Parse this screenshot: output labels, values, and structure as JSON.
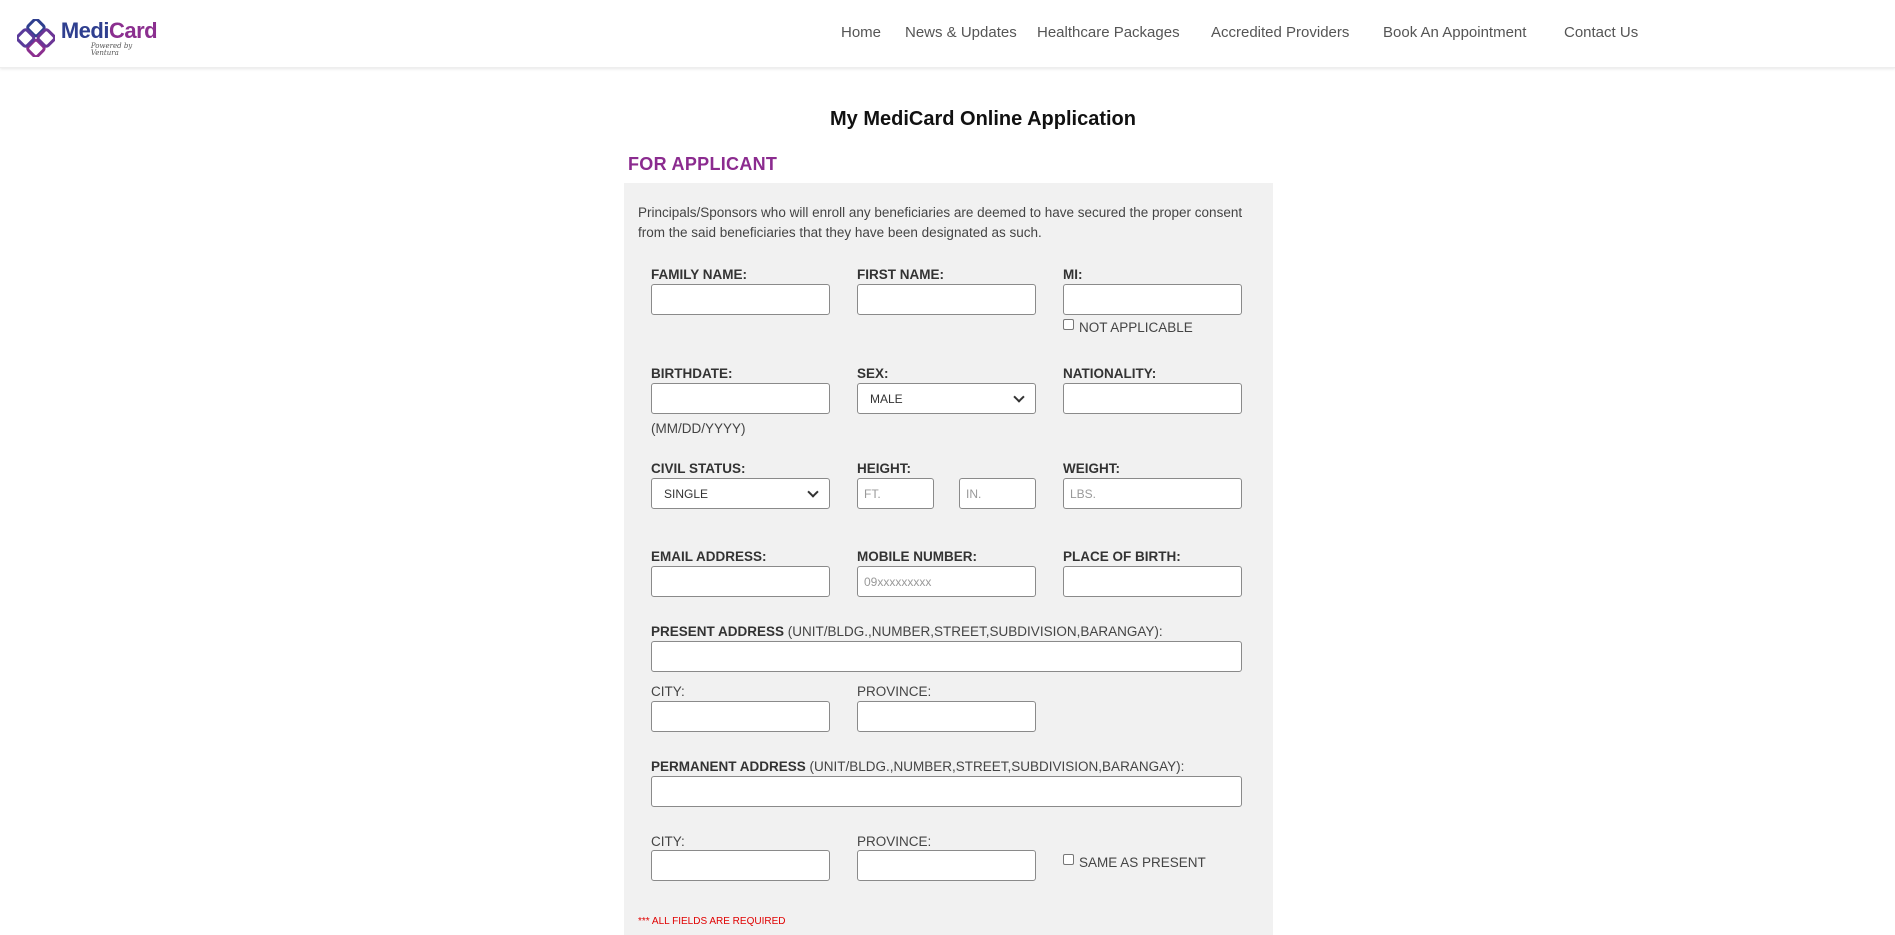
{
  "brand": {
    "name_part1": "Medi",
    "name_part2": "Card",
    "tagline": "Powered by Ventura",
    "colors": {
      "primary": "#2f3f8f",
      "accent": "#8b2f8f"
    }
  },
  "nav": {
    "items": [
      {
        "label": "Home"
      },
      {
        "label": "News & Updates"
      },
      {
        "label": "Healthcare Packages"
      },
      {
        "label": "Accredited Providers"
      },
      {
        "label": "Book An Appointment"
      },
      {
        "label": "Contact Us"
      }
    ]
  },
  "page": {
    "title": "My MediCard Online Application",
    "section_title": "FOR APPLICANT",
    "consent": "Principals/Sponsors who will enroll any beneficiaries are deemed to have secured the proper consent from the said beneficiaries that they have been designated as such."
  },
  "form": {
    "family_name": {
      "label": "FAMILY NAME:",
      "value": ""
    },
    "first_name": {
      "label": "FIRST NAME:",
      "value": ""
    },
    "mi": {
      "label": "MI:",
      "value": "",
      "not_applicable_label": "NOT APPLICABLE"
    },
    "birthdate": {
      "label": "BIRTHDATE:",
      "value": "",
      "hint": "(MM/DD/YYYY)"
    },
    "sex": {
      "label": "SEX:",
      "selected": "MALE"
    },
    "nationality": {
      "label": "NATIONALITY:",
      "value": ""
    },
    "civil_status": {
      "label": "CIVIL STATUS:",
      "selected": "SINGLE"
    },
    "height": {
      "label": "HEIGHT:",
      "ft_placeholder": "FT.",
      "in_placeholder": "IN."
    },
    "weight": {
      "label": "WEIGHT:",
      "placeholder": "LBS."
    },
    "email": {
      "label": "EMAIL ADDRESS:",
      "value": ""
    },
    "mobile": {
      "label": "MOBILE NUMBER:",
      "placeholder": "09xxxxxxxxx"
    },
    "place_of_birth": {
      "label": "PLACE OF BIRTH:",
      "value": ""
    },
    "present_address": {
      "label": "PRESENT ADDRESS",
      "hint": " (UNIT/BLDG.,NUMBER,STREET,SUBDIVISION,BARANGAY):"
    },
    "present_city": {
      "label": "CITY:"
    },
    "present_province": {
      "label": "PROVINCE:"
    },
    "permanent_address": {
      "label": "PERMANENT ADDRESS",
      "hint": " (UNIT/BLDG.,NUMBER,STREET,SUBDIVISION,BARANGAY):"
    },
    "permanent_city": {
      "label": "CITY:"
    },
    "permanent_province": {
      "label": "PROVINCE:"
    },
    "same_as_present_label": "SAME AS PRESENT",
    "required_note": "*** ALL FIELDS ARE REQUIRED"
  }
}
